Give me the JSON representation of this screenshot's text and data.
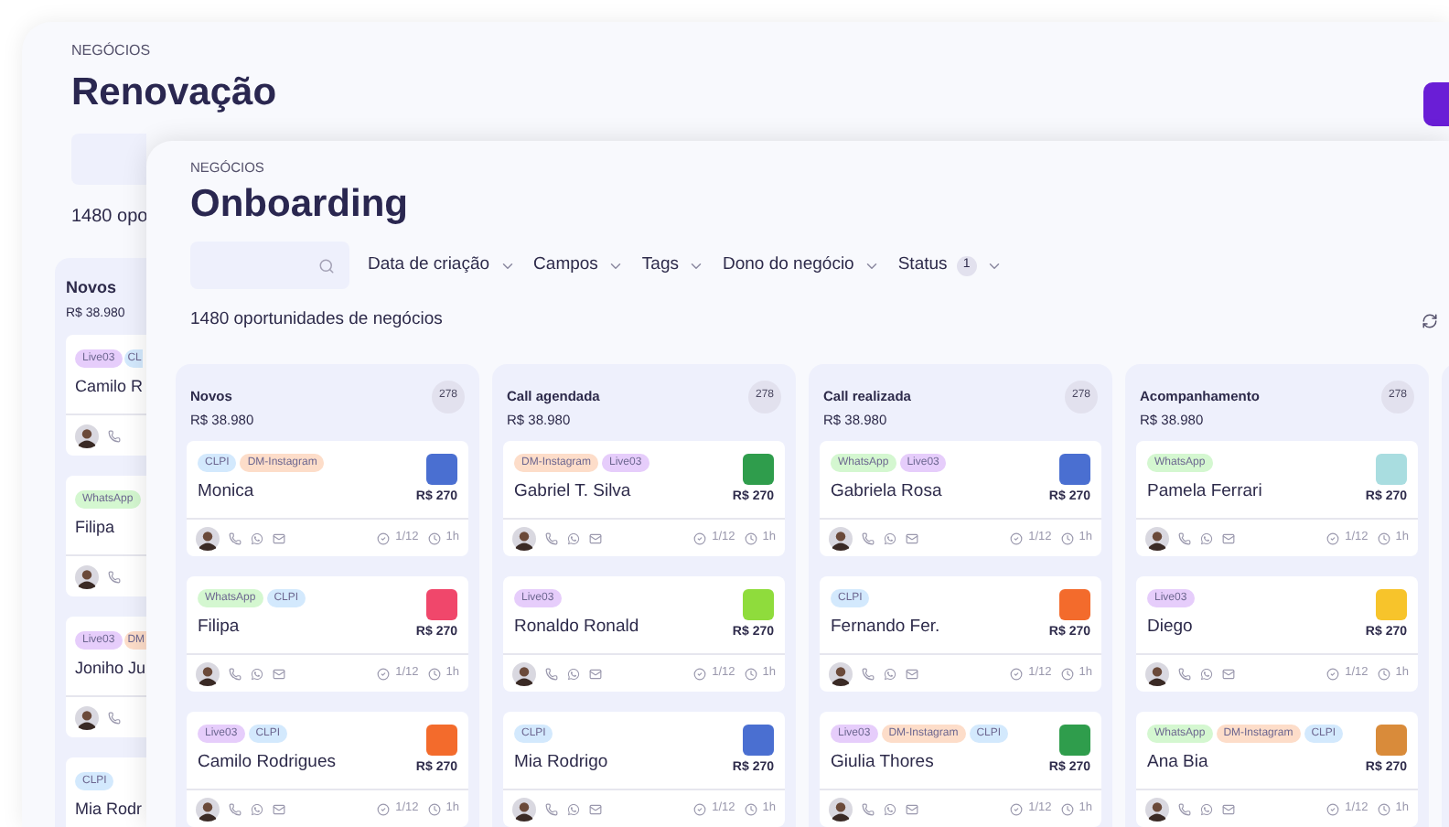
{
  "back_window": {
    "section": "NEGÓCIOS",
    "title": "Renovação",
    "count_text": "1480 opo",
    "column": {
      "title": "Novos",
      "amount": "R$ 38.980",
      "cards": [
        {
          "name": "Camilo R",
          "tags": [
            {
              "label": "Live03",
              "color": "#e6cdfb"
            },
            {
              "label": "CL",
              "color": "#d3e9fd",
              "kind": "cut"
            }
          ]
        },
        {
          "name": "Filipa",
          "tags": [
            {
              "label": "WhatsApp",
              "color": "#d4f7d0"
            }
          ]
        },
        {
          "name": "Joniho Ju",
          "tags": [
            {
              "label": "Live03",
              "color": "#e6cdfb"
            },
            {
              "label": "DM",
              "color": "#fdddc9",
              "kind": "cut"
            }
          ]
        },
        {
          "name": "Mia Rodr",
          "tags": [
            {
              "label": "CLPI",
              "color": "#d3e9fd"
            }
          ]
        }
      ]
    }
  },
  "window": {
    "section": "NEGÓCIOS",
    "title": "Onboarding",
    "filters": [
      {
        "label": "Data de criação"
      },
      {
        "label": "Campos"
      },
      {
        "label": "Tags"
      },
      {
        "label": "Dono do negócio"
      },
      {
        "label": "Status",
        "badge": "1"
      }
    ],
    "count_text": "1480 oportunidades de negócios",
    "columns": [
      {
        "title": "Novos",
        "count": "278",
        "amount": "R$ 38.980",
        "cards": [
          {
            "name": "Monica",
            "amount": "R$ 270",
            "color": "#4a6fd1",
            "tasks": "1/12",
            "time": "1h",
            "tags": [
              {
                "label": "CLPI",
                "color": "#d3e9fd"
              },
              {
                "label": "DM-Instagram",
                "color": "#fdddc9"
              }
            ]
          },
          {
            "name": "Filipa",
            "amount": "R$ 270",
            "color": "#f0476b",
            "tasks": "1/12",
            "time": "1h",
            "tags": [
              {
                "label": "WhatsApp",
                "color": "#d4f7d0"
              },
              {
                "label": "CLPI",
                "color": "#d3e9fd"
              }
            ]
          },
          {
            "name": "Camilo Rodrigues",
            "amount": "R$ 270",
            "color": "#f36b2c",
            "tasks": "1/12",
            "time": "1h",
            "tags": [
              {
                "label": "Live03",
                "color": "#e6cdfb"
              },
              {
                "label": "CLPI",
                "color": "#d3e9fd"
              }
            ]
          }
        ]
      },
      {
        "title": "Call agendada",
        "count": "278",
        "amount": "R$ 38.980",
        "cards": [
          {
            "name": "Gabriel T. Silva",
            "amount": "R$ 270",
            "color": "#2f9d4c",
            "tasks": "1/12",
            "time": "1h",
            "tags": [
              {
                "label": "DM-Instagram",
                "color": "#fdddc9"
              },
              {
                "label": "Live03",
                "color": "#e6cdfb"
              }
            ]
          },
          {
            "name": "Ronaldo Ronald",
            "amount": "R$ 270",
            "color": "#8fdc3c",
            "tasks": "1/12",
            "time": "1h",
            "tags": [
              {
                "label": "Live03",
                "color": "#e6cdfb"
              }
            ]
          },
          {
            "name": "Mia Rodrigo",
            "amount": "R$ 270",
            "color": "#4a6fd1",
            "tasks": "1/12",
            "time": "1h",
            "tags": [
              {
                "label": "CLPI",
                "color": "#d3e9fd"
              }
            ]
          }
        ]
      },
      {
        "title": "Call realizada",
        "count": "278",
        "amount": "R$ 38.980",
        "cards": [
          {
            "name": "Gabriela Rosa",
            "amount": "R$ 270",
            "color": "#4a6fd1",
            "tasks": "1/12",
            "time": "1h",
            "tags": [
              {
                "label": "WhatsApp",
                "color": "#d4f7d0"
              },
              {
                "label": "Live03",
                "color": "#e6cdfb"
              }
            ]
          },
          {
            "name": "Fernando Fer.",
            "amount": "R$ 270",
            "color": "#f36b2c",
            "tasks": "1/12",
            "time": "1h",
            "tags": [
              {
                "label": "CLPI",
                "color": "#d3e9fd"
              }
            ]
          },
          {
            "name": "Giulia Thores",
            "amount": "R$ 270",
            "color": "#2f9d4c",
            "tasks": "1/12",
            "time": "1h",
            "tags": [
              {
                "label": "Live03",
                "color": "#e6cdfb"
              },
              {
                "label": "DM-Instagram",
                "color": "#fdddc9"
              },
              {
                "label": "CLPI",
                "color": "#d3e9fd"
              }
            ]
          }
        ]
      },
      {
        "title": "Acompanhamento",
        "count": "278",
        "amount": "R$ 38.980",
        "cards": [
          {
            "name": "Pamela Ferrari",
            "amount": "R$ 270",
            "color": "#a9dde0",
            "tasks": "1/12",
            "time": "1h",
            "tags": [
              {
                "label": "WhatsApp",
                "color": "#d4f7d0"
              }
            ]
          },
          {
            "name": "Diego",
            "amount": "R$ 270",
            "color": "#f7c42b",
            "tasks": "1/12",
            "time": "1h",
            "tags": [
              {
                "label": "Live03",
                "color": "#e6cdfb"
              }
            ]
          },
          {
            "name": "Ana Bia",
            "amount": "R$ 270",
            "color": "#d98b3a",
            "tasks": "1/12",
            "time": "1h",
            "tags": [
              {
                "label": "WhatsApp",
                "color": "#d4f7d0"
              },
              {
                "label": "DM-Instagram",
                "color": "#fdddc9"
              },
              {
                "label": "CLPI",
                "color": "#d3e9fd"
              }
            ]
          }
        ]
      }
    ]
  }
}
